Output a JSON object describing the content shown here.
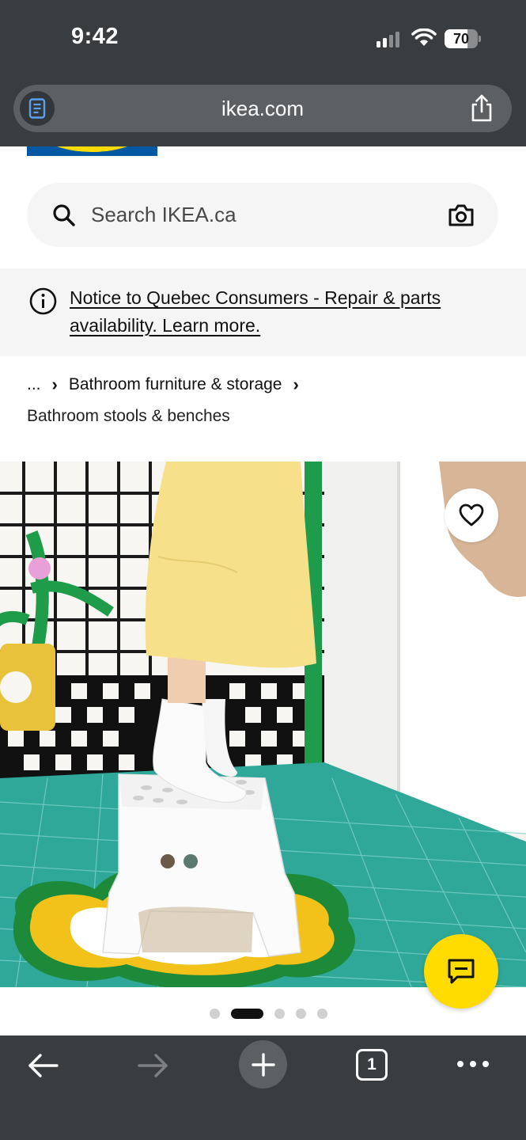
{
  "status_bar": {
    "time": "9:42",
    "battery_level": "70",
    "battery_fraction": 0.7
  },
  "browser": {
    "url": "ikea.com"
  },
  "search": {
    "placeholder": "Search IKEA.ca"
  },
  "notice": {
    "text": "Notice to Quebec Consumers - Repair & parts availability. Learn more."
  },
  "breadcrumb": {
    "ellipsis": "...",
    "parent": "Bathroom furniture & storage",
    "current": "Bathroom stools & benches"
  },
  "carousel": {
    "total": 5,
    "active_index": 1
  },
  "bottom_bar": {
    "tab_count": "1"
  },
  "colors": {
    "brand_blue": "#0058a3",
    "brand_yellow": "#ffdb00",
    "chrome": "#3a3d3f"
  }
}
